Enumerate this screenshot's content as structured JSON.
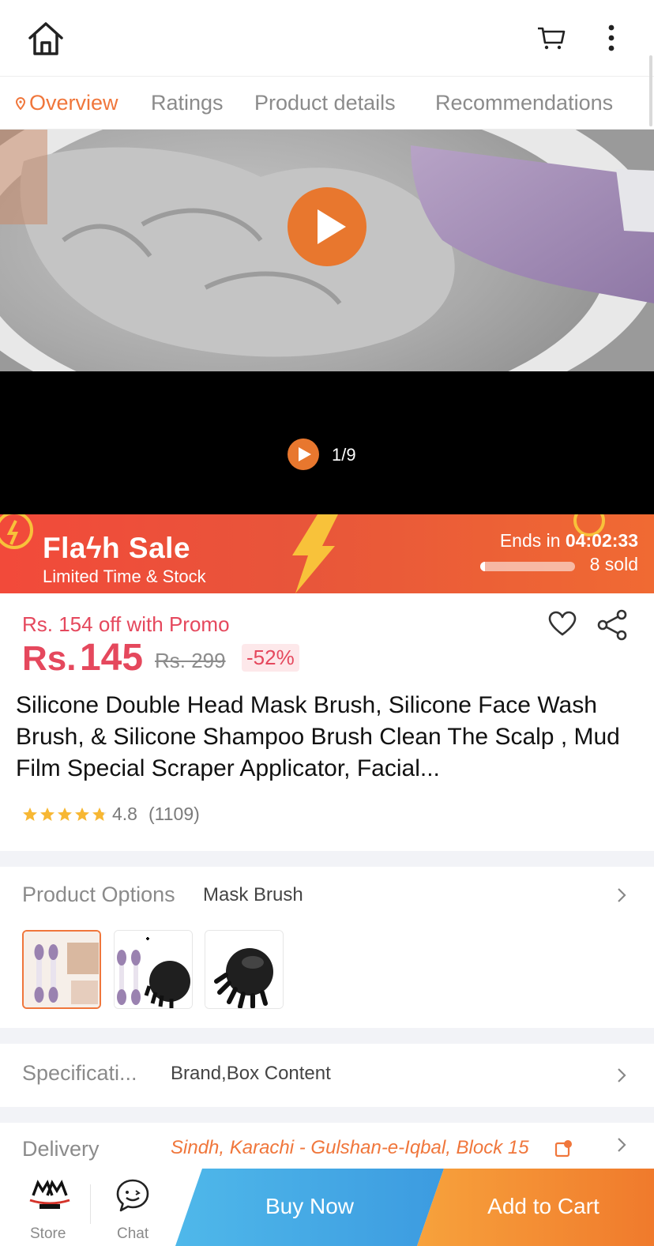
{
  "tabs": {
    "overview": "Overview",
    "ratings": "Ratings",
    "product_details": "Product details",
    "recommendations": "Recommendations"
  },
  "media": {
    "counter": "1/9"
  },
  "flash_sale": {
    "title": "Flaϟh Sale",
    "subtitle": "Limited Time & Stock",
    "ends_label": "Ends in",
    "countdown": "04:02:33",
    "sold": "8 sold",
    "sold_progress": 0.05
  },
  "pricing": {
    "promo": "Rs. 154 off with Promo",
    "currency": "Rs.",
    "price": "145",
    "original": "Rs. 299",
    "discount": "-52%"
  },
  "product": {
    "title": "Silicone Double Head Mask Brush, Silicone Face Wash Brush, & Silicone Shampoo Brush Clean The Scalp , Mud Film Special Scraper Applicator, Facial...",
    "rating_score": "4.8",
    "rating_count": "(1109)",
    "stars": 4.8
  },
  "options": {
    "label": "Product Options",
    "selected": "Mask Brush"
  },
  "specifications": {
    "label": "Specificati...",
    "value": "Brand,Box Content"
  },
  "delivery": {
    "label": "Delivery",
    "address": "Sindh, Karachi - Gulshan-e-Iqbal, Block 15"
  },
  "bottom_bar": {
    "store": "Store",
    "chat": "Chat",
    "buy_now": "Buy Now",
    "add_to_cart": "Add to Cart"
  },
  "colors": {
    "accent": "#f0763b",
    "price": "#e5485d",
    "buy_now": "#4fb8ea",
    "add_to_cart": "#f28a33"
  }
}
